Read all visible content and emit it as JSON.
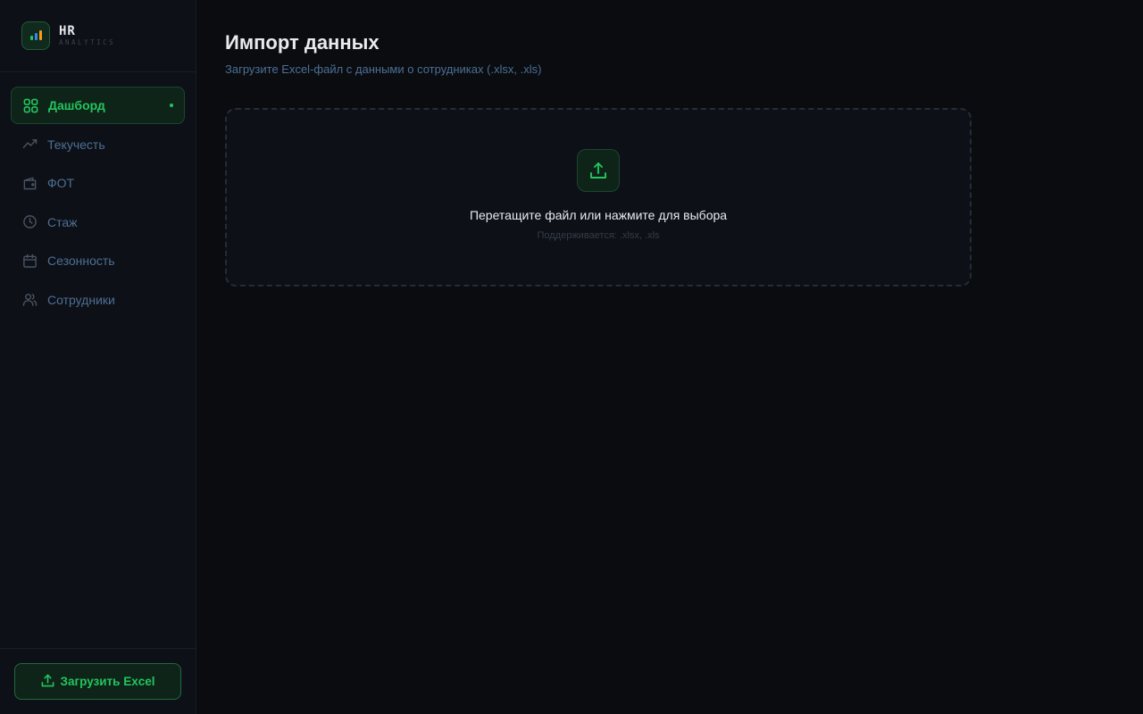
{
  "brand": {
    "title": "HR",
    "subtitle": "ANALYTICS"
  },
  "nav": {
    "items": [
      {
        "label": "Дашборд",
        "icon": "grid-icon",
        "active": true
      },
      {
        "label": "Текучесть",
        "icon": "trending-icon",
        "active": false
      },
      {
        "label": "ФОТ",
        "icon": "wallet-icon",
        "active": false
      },
      {
        "label": "Стаж",
        "icon": "clock-icon",
        "active": false
      },
      {
        "label": "Сезонность",
        "icon": "calendar-icon",
        "active": false
      },
      {
        "label": "Сотрудники",
        "icon": "users-icon",
        "active": false
      }
    ]
  },
  "sidebar_footer": {
    "upload_label": "Загрузить Excel"
  },
  "main": {
    "title": "Импорт данных",
    "subtitle": "Загрузите Excel-файл с данными о сотрудниках (.xlsx, .xls)"
  },
  "dropzone": {
    "title": "Перетащите файл или нажмите для выбора",
    "hint": "Поддерживается: .xlsx, .xls"
  },
  "colors": {
    "accent": "#22c55e",
    "background": "#0a0c10",
    "sidebar": "#0d1016",
    "muted_text": "#4d6f96"
  }
}
